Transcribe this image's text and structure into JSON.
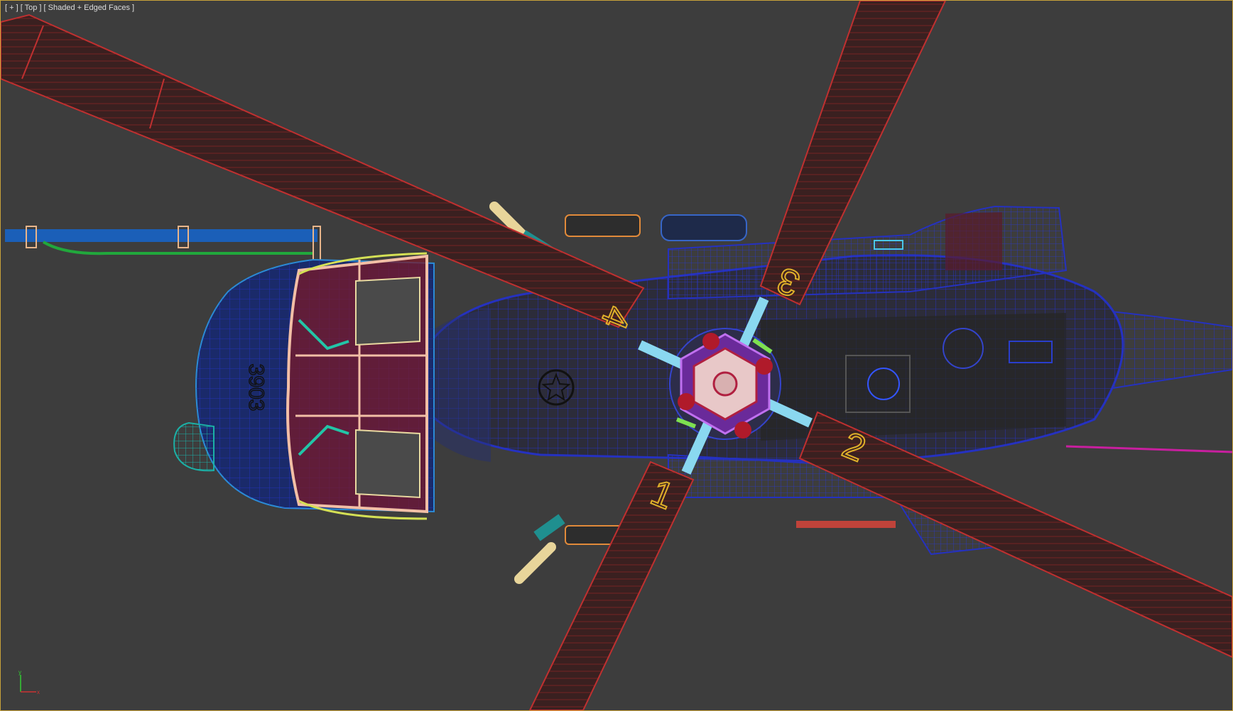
{
  "viewport": {
    "label_parts": [
      "[ + ]",
      "[ Top ]",
      "[ Shaded + Edged Faces ]"
    ],
    "view_name": "Top",
    "shading_mode": "Shaded + Edged Faces"
  },
  "scene": {
    "object": "helicopter",
    "blade_numbers": [
      "1",
      "2",
      "3",
      "4"
    ],
    "nose_number": "3903"
  },
  "axis": {
    "x": "x",
    "y": "y"
  },
  "colors": {
    "background": "#3d3d3d",
    "viewport_border": "#c8a23a",
    "blade_fill": "#3a2020",
    "blade_wire": "#c03030",
    "fuselage_wire": "#2233cc",
    "label_text": "#dcdcdc"
  }
}
